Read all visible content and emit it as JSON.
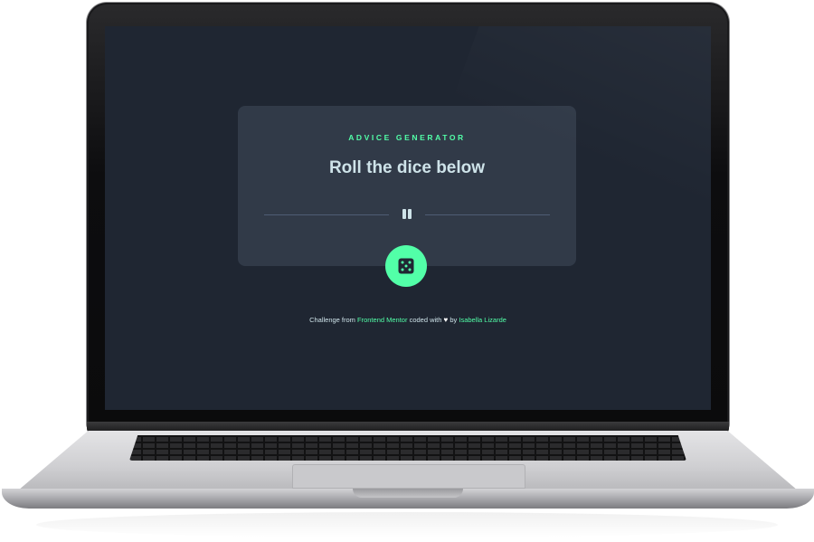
{
  "app": {
    "kicker": "ADVICE GENERATOR",
    "advice_text": "Roll the dice below",
    "dice_button_icon": "dice-icon",
    "divider_icon": "pause-icon"
  },
  "footer": {
    "prefix": "Challenge from",
    "link1": "Frontend Mentor",
    "middle": "coded with",
    "heart_icon": "heart-icon",
    "by": "by",
    "link2": "Isabella Lizarde"
  },
  "colors": {
    "background": "#1f2632",
    "card": "#313a48",
    "accent": "#52ffa8",
    "text": "#cee3e9",
    "divider": "#4f5d74"
  }
}
